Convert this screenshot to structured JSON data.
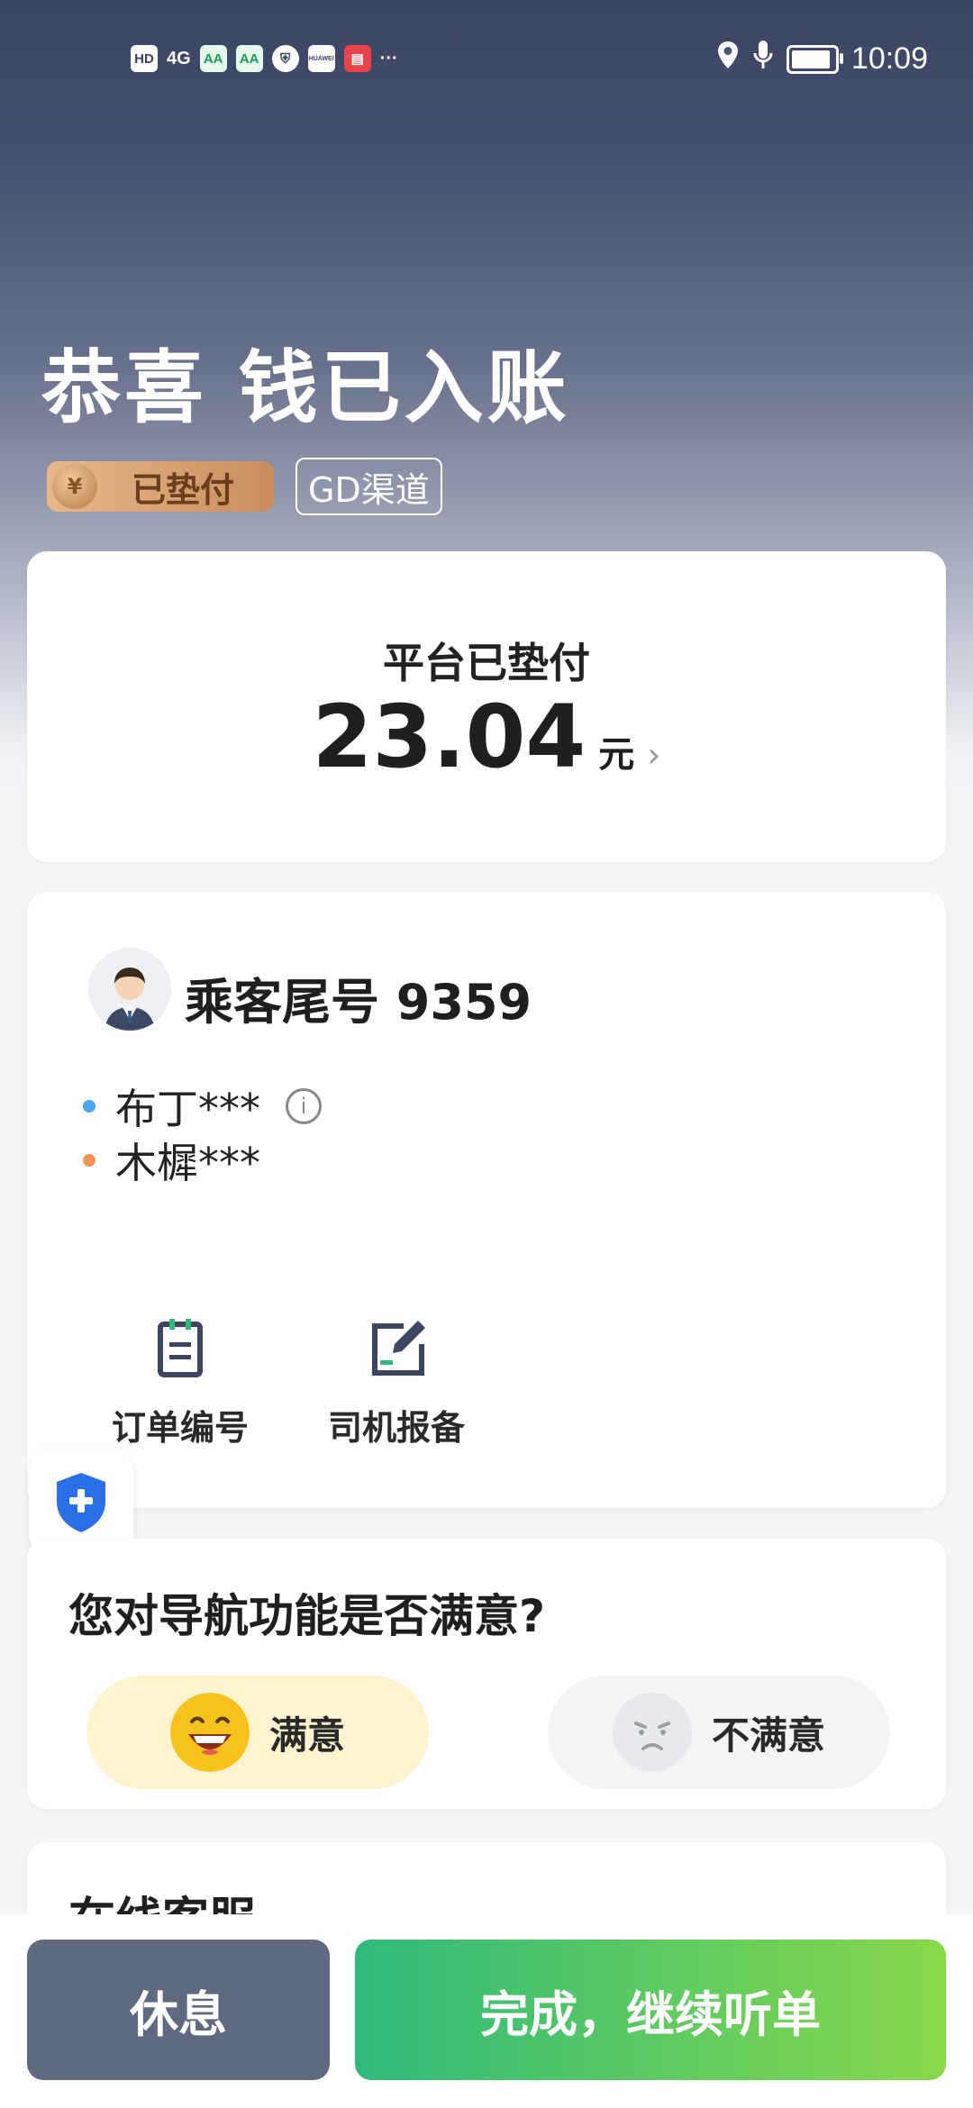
{
  "status_bar": {
    "time": "10:09",
    "left_icons": [
      "hd-icon",
      "signal-4g-icon",
      "app-aa-icon",
      "app-aa-icon",
      "shield-app-icon",
      "huawei-app-icon",
      "red-app-icon",
      "more-dots-icon"
    ],
    "right_icons": [
      "location-icon",
      "mic-icon",
      "battery-icon"
    ],
    "chip_hd": "HD",
    "chip_4g": "4G",
    "chip_aa": "AA",
    "chip_hw": "HUAWEI",
    "more": "···"
  },
  "hero": {
    "title": "恭喜 钱已入账",
    "tag_paid": "已垫付",
    "coin_symbol": "¥",
    "tag_channel": "GD渠道"
  },
  "payment_card": {
    "title": "平台已垫付",
    "amount": "23.04",
    "unit": "元",
    "chevron": "›"
  },
  "passenger_card": {
    "title": "乘客尾号 9359",
    "tags": [
      {
        "text": "布丁***",
        "color": "#4da2f1",
        "has_info": true
      },
      {
        "text": "木樨***",
        "color": "#f4935a",
        "has_info": false
      }
    ],
    "info_glyph": "i",
    "tools": [
      {
        "label": "订单编号",
        "icon": "order-number-icon"
      },
      {
        "label": "司机报备",
        "icon": "driver-report-icon"
      }
    ]
  },
  "safety": {
    "icon": "safety-shield-icon"
  },
  "survey": {
    "question": "您对导航功能是否满意?",
    "options": [
      {
        "label": "满意",
        "icon": "happy-face-icon"
      },
      {
        "label": "不满意",
        "icon": "unhappy-face-icon"
      }
    ]
  },
  "service": {
    "title": "在线客服"
  },
  "bottom_bar": {
    "rest_label": "休息",
    "done_label": "完成，继续听单"
  },
  "colors": {
    "accent_green_start": "#2fba7b",
    "accent_green_end": "#88d84a",
    "rest_button": "#5f6a80",
    "paid_tag": "#d9a679"
  }
}
